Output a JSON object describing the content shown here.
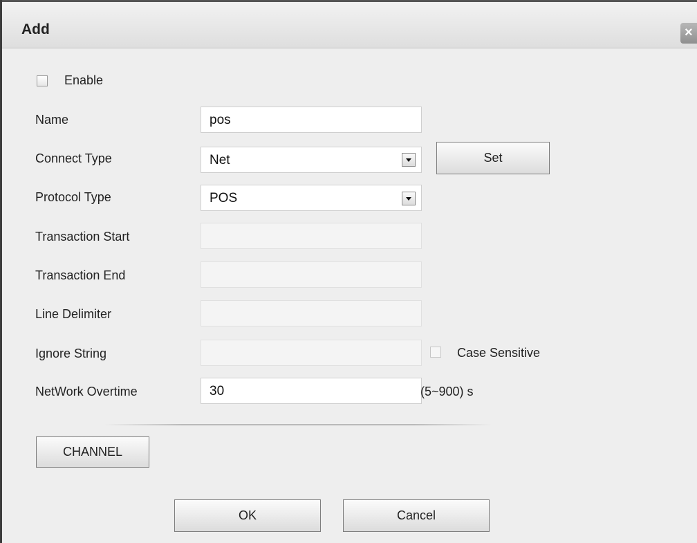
{
  "dialog": {
    "title": "Add",
    "close_glyph": "×"
  },
  "form": {
    "enable_label": "Enable",
    "name_label": "Name",
    "name_value": "pos",
    "connect_type_label": "Connect Type",
    "connect_type_value": "Net",
    "set_button": "Set",
    "protocol_type_label": "Protocol Type",
    "protocol_type_value": "POS",
    "transaction_start_label": "Transaction Start",
    "transaction_start_value": "",
    "transaction_end_label": "Transaction End",
    "transaction_end_value": "",
    "line_delimiter_label": "Line Delimiter",
    "line_delimiter_value": "",
    "ignore_string_label": "Ignore String",
    "ignore_string_value": "",
    "case_sensitive_label": "Case Sensitive",
    "network_overtime_label": "NetWork Overtime",
    "network_overtime_value": "30",
    "network_overtime_range": "(5~900) s"
  },
  "buttons": {
    "channel": "CHANNEL",
    "ok": "OK",
    "cancel": "Cancel"
  },
  "icons": {
    "close": "close-icon",
    "dropdown": "chevron-down-icon"
  }
}
